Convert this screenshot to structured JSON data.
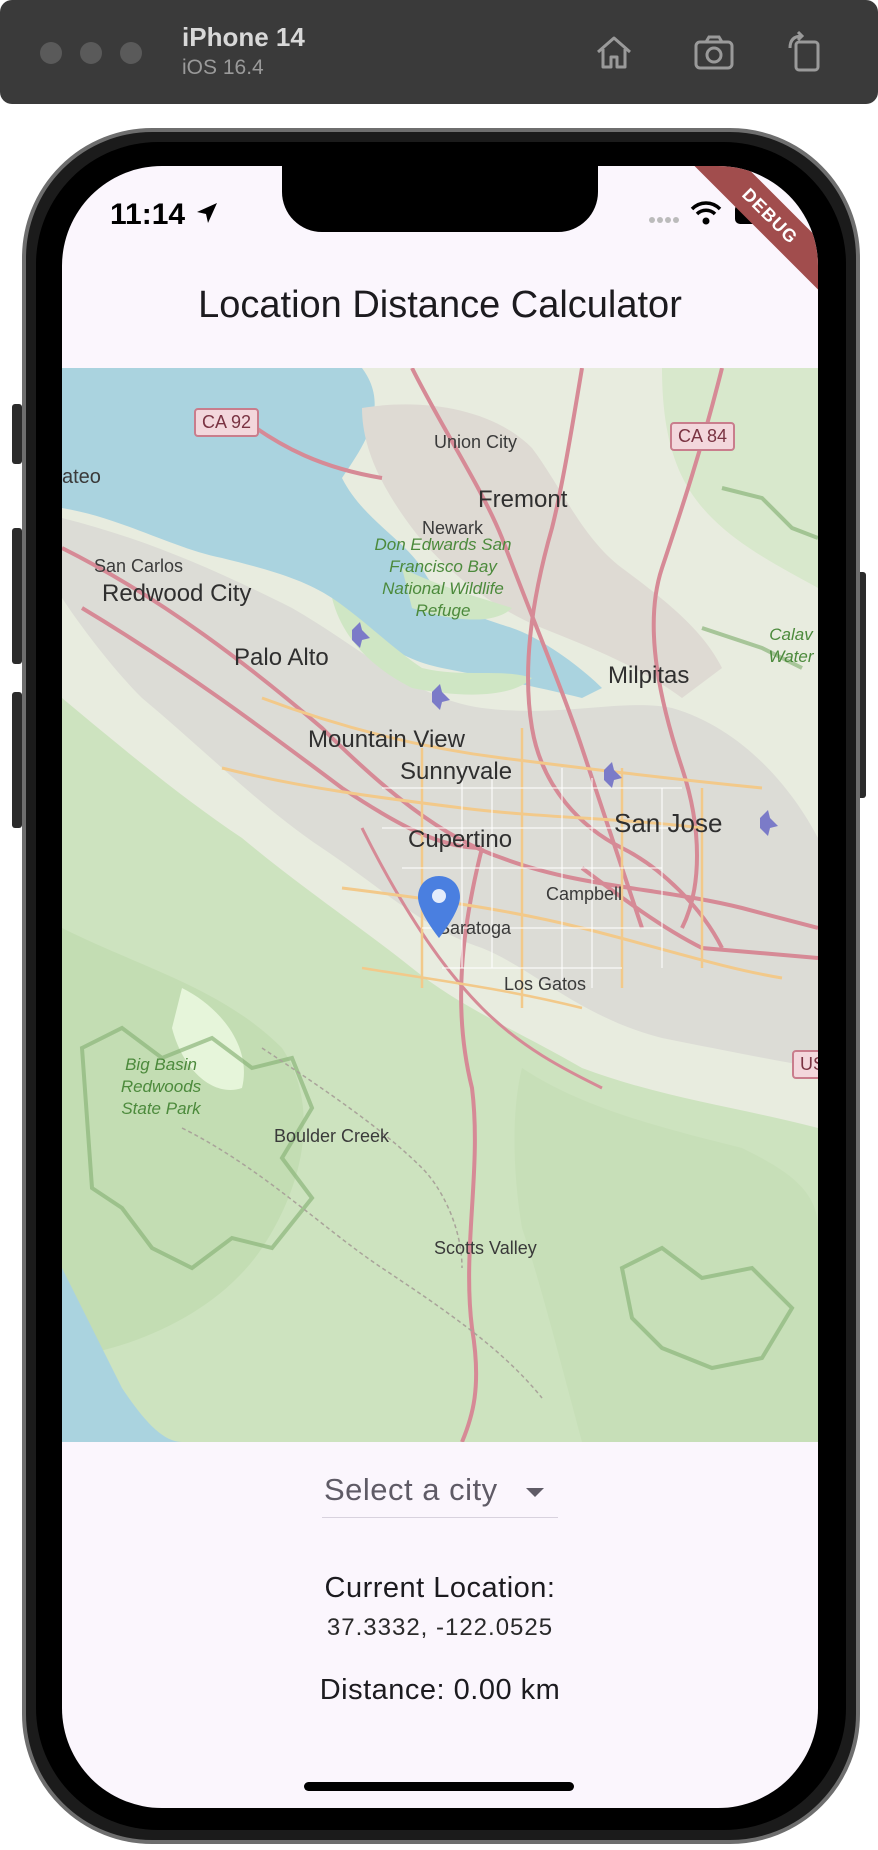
{
  "simulator": {
    "device_name": "iPhone 14",
    "os_version": "iOS 16.4"
  },
  "status_bar": {
    "time": "11:14",
    "debug_label": "DEBUG"
  },
  "app": {
    "title": "Location Distance Calculator"
  },
  "map": {
    "labels": {
      "union_city": "Union City",
      "fremont": "Fremont",
      "newark": "Newark",
      "don_edwards": "Don Edwards San Francisco Bay National Wildlife Refuge",
      "san_carlos": "San Carlos",
      "redwood_city": "Redwood City",
      "palo_alto": "Palo Alto",
      "milpitas": "Milpitas",
      "mountain_view": "Mountain View",
      "sunnyvale": "Sunnyvale",
      "san_jose": "San Jose",
      "cupertino": "Cupertino",
      "campbell": "Campbell",
      "saratoga": "Saratoga",
      "los_gatos": "Los Gatos",
      "big_basin": "Big Basin Redwoods State Park",
      "boulder_creek": "Boulder Creek",
      "scotts_valley": "Scotts Valley",
      "calaveras": "Calav Water",
      "mateo": "ateo",
      "ca92": "CA 92",
      "ca84": "CA 84",
      "us": "US"
    },
    "marker": "location-pin",
    "marker_color": "#4a7fe0"
  },
  "city_select": {
    "placeholder": "Select a city"
  },
  "info": {
    "current_location_label": "Current Location:",
    "coordinates": "37.3332, -122.0525",
    "distance": "Distance: 0.00 km"
  }
}
